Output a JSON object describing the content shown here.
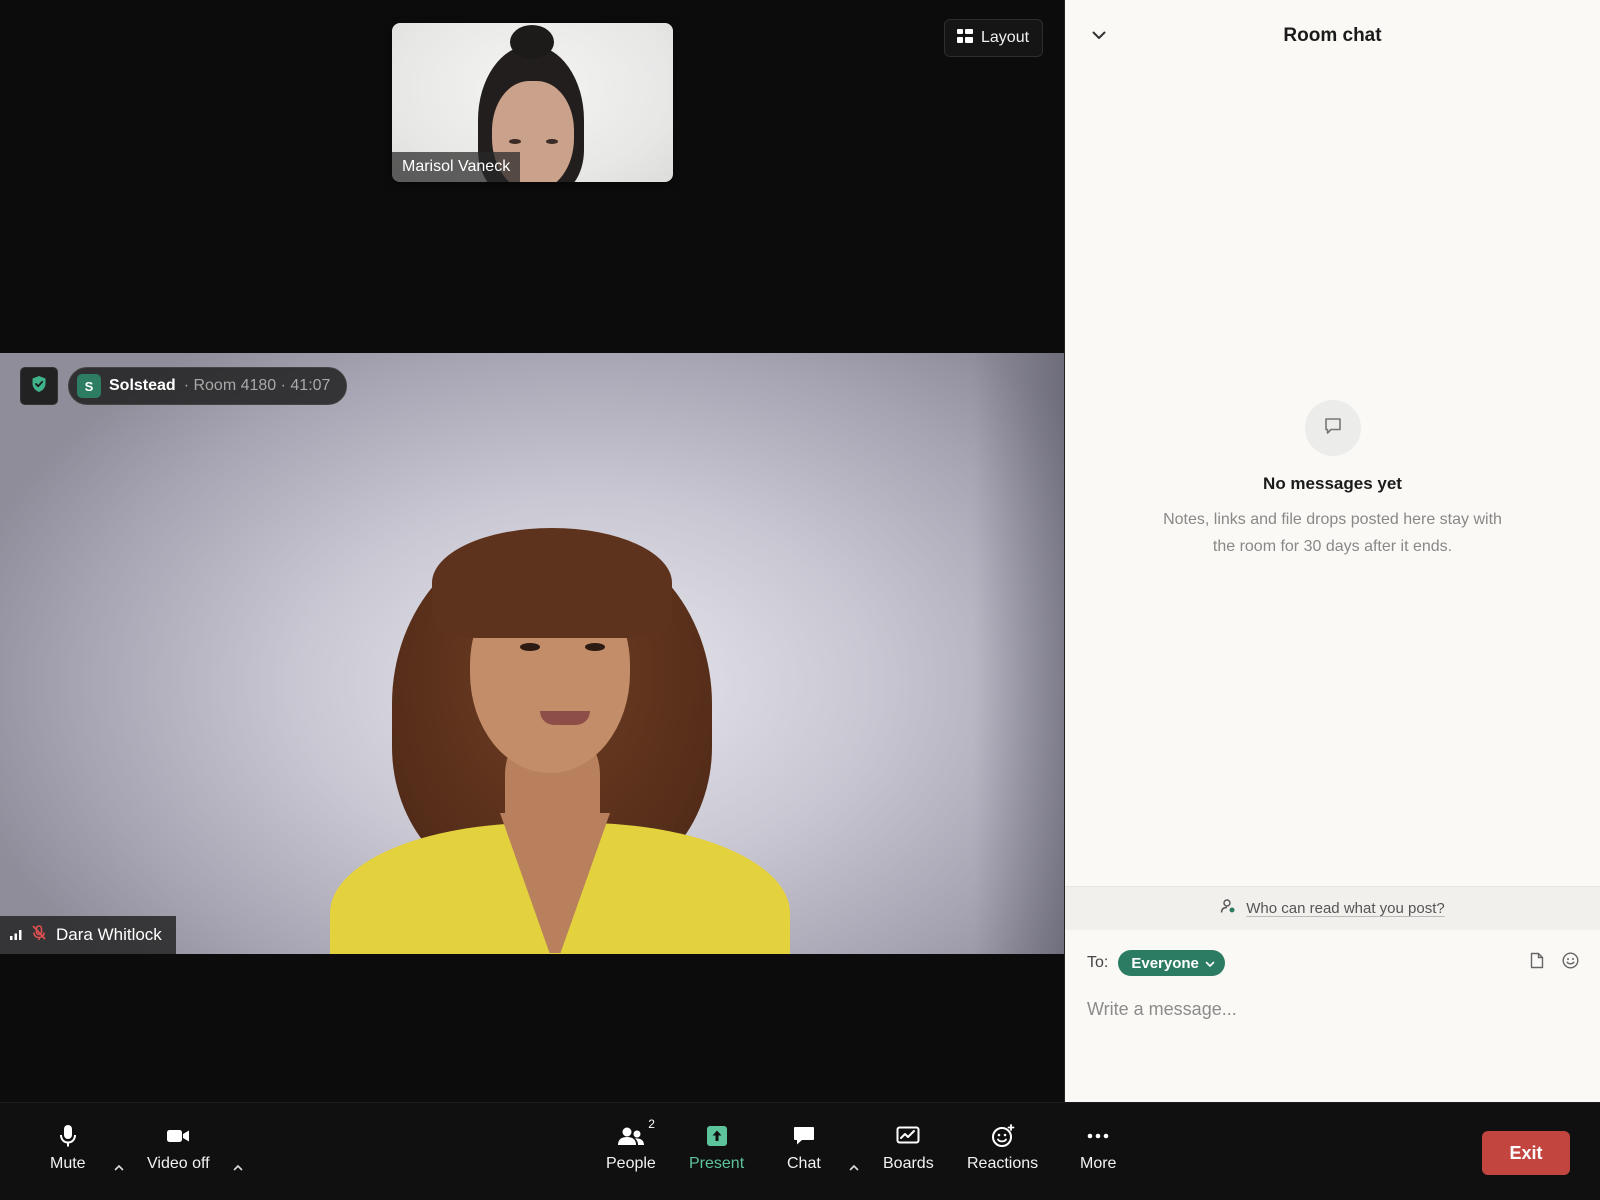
{
  "stage": {
    "thumbnail": {
      "participant_name": "Marisol Vaneck"
    },
    "layout_button": {
      "label": "Layout"
    },
    "room": {
      "org_initial": "S",
      "org_name": "Solstead",
      "details": "· Room 4180 · 41:07"
    },
    "speaker": {
      "name": "Dara Whitlock"
    }
  },
  "chat": {
    "title": "Room chat",
    "empty": {
      "title": "No messages yet",
      "description": "Notes, links and file drops posted here stay with the room for 30 days after it ends."
    },
    "privacy_link": "Who can read what you post?",
    "to_label": "To:",
    "recipient": "Everyone",
    "input_placeholder": "Write a message..."
  },
  "toolbar": {
    "mute": "Mute",
    "video": "Video off",
    "people": "People",
    "people_count": "2",
    "present": "Present",
    "chat": "Chat",
    "boards": "Boards",
    "reactions": "Reactions",
    "more": "More",
    "exit": "Exit"
  },
  "colors": {
    "accent_green": "#2c7c63",
    "present_green": "#5cc39a",
    "exit_red": "#c2453f",
    "muted_red": "#e05050"
  }
}
